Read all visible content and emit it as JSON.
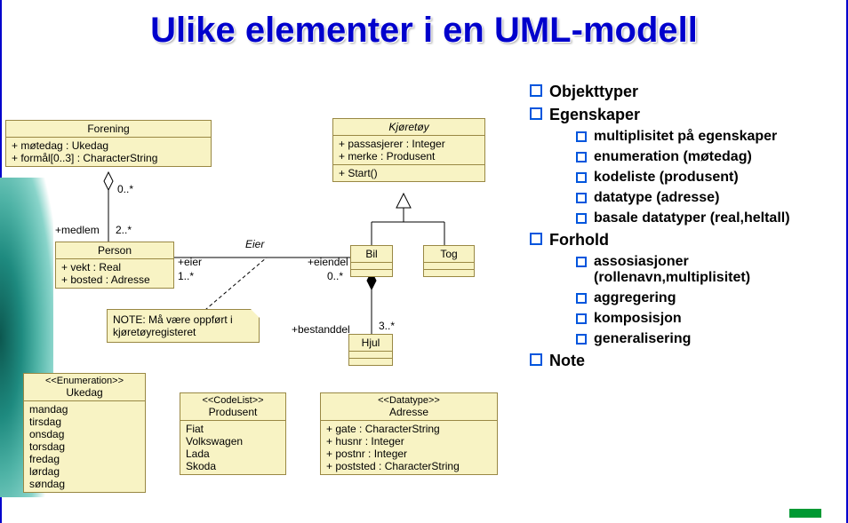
{
  "title": "Ulike elementer i en UML-modell",
  "classes": {
    "forening": {
      "name": "Forening",
      "attrs": [
        "+ møtedag : Ukedag",
        "+ formål[0..3] : CharacterString"
      ]
    },
    "person": {
      "name": "Person",
      "attrs": [
        "+ vekt : Real",
        "+ bosted : Adresse"
      ]
    },
    "kjoretoy": {
      "name": "Kjøretøy",
      "attrs": [
        "+ passasjerer : Integer",
        "+ merke : Produsent"
      ],
      "ops": [
        "+ Start()"
      ]
    },
    "bil": {
      "name": "Bil"
    },
    "tog": {
      "name": "Tog"
    },
    "hjul": {
      "name": "Hjul"
    },
    "ukedag": {
      "stereotype": "<<Enumeration>>",
      "name": "Ukedag",
      "values": [
        "mandag",
        "tirsdag",
        "onsdag",
        "torsdag",
        "fredag",
        "lørdag",
        "søndag"
      ]
    },
    "produsent": {
      "stereotype": "<<CodeList>>",
      "name": "Produsent",
      "values": [
        "Fiat",
        "Volkswagen",
        "Lada",
        "Skoda"
      ]
    },
    "adresse": {
      "stereotype": "<<Datatype>>",
      "name": "Adresse",
      "attrs": [
        "+ gate : CharacterString",
        "+ husnr : Integer",
        "+ postnr : Integer",
        "+ poststed : CharacterString"
      ]
    }
  },
  "note": "NOTE: Må være oppført i kjøretøyregisteret",
  "labels": {
    "medlem_assoc_top": "0..*",
    "medlem_role": "+medlem",
    "medlem_mult": "2..*",
    "eier_assoc": "Eier",
    "eier_role": "+eier",
    "eier_mult": "1..*",
    "eiendel_role": "+eiendel",
    "eiendel_mult": "0..*",
    "bestanddel_role": "+bestanddel",
    "bestanddel_mult": "3..*"
  },
  "bullets": {
    "objekttyper": "Objekttyper",
    "egenskaper": "Egenskaper",
    "egenskaper_sub": [
      "multiplisitet på egenskaper",
      "enumeration (møtedag)",
      "kodeliste (produsent)",
      "datatype (adresse)",
      "basale datatyper (real,heltall)"
    ],
    "forhold": "Forhold",
    "forhold_sub": [
      "assosiasjoner (rollenavn,multiplisitet)",
      "aggregering",
      "komposisjon",
      "generalisering"
    ],
    "note": "Note"
  }
}
